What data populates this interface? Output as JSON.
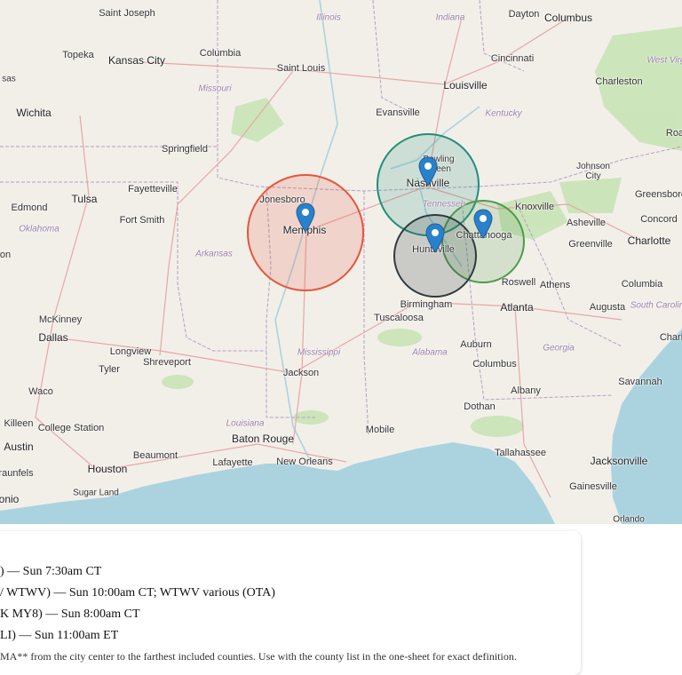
{
  "map": {
    "cities": [
      {
        "name": "Saint Joseph"
      },
      {
        "name": "Topeka"
      },
      {
        "name": "Kansas City"
      },
      {
        "name": "Columbia"
      },
      {
        "name": "Saint Louis"
      },
      {
        "name": "Wichita"
      },
      {
        "name": "Springfield"
      },
      {
        "name": "Fayetteville"
      },
      {
        "name": "Tulsa"
      },
      {
        "name": "Edmond"
      },
      {
        "name": "Fort Smith"
      },
      {
        "name": "Jonesboro"
      },
      {
        "name": "Memphis"
      },
      {
        "name": "McKinney"
      },
      {
        "name": "Dallas"
      },
      {
        "name": "Longview"
      },
      {
        "name": "Tyler"
      },
      {
        "name": "Shreveport"
      },
      {
        "name": "Waco"
      },
      {
        "name": "Killeen"
      },
      {
        "name": "College Station"
      },
      {
        "name": "Austin"
      },
      {
        "name": "Houston"
      },
      {
        "name": "Sugar Land"
      },
      {
        "name": "Beaumont"
      },
      {
        "name": "Lafayette"
      },
      {
        "name": "Baton Rouge"
      },
      {
        "name": "New Orleans"
      },
      {
        "name": "Jackson"
      },
      {
        "name": "Mobile"
      },
      {
        "name": "Tuscaloosa"
      },
      {
        "name": "Birmingham"
      },
      {
        "name": "Huntsville"
      },
      {
        "name": "Nashville"
      },
      {
        "name": "Bowling Green"
      },
      {
        "name": "Chattanooga"
      },
      {
        "name": "Knoxville"
      },
      {
        "name": "Johnson City"
      },
      {
        "name": "Asheville"
      },
      {
        "name": "Greenville"
      },
      {
        "name": "Charlotte"
      },
      {
        "name": "Greensboro"
      },
      {
        "name": "Concord"
      },
      {
        "name": "Roswell"
      },
      {
        "name": "Athens"
      },
      {
        "name": "Atlanta"
      },
      {
        "name": "Augusta"
      },
      {
        "name": "Columbia"
      },
      {
        "name": "Auburn"
      },
      {
        "name": "Columbus"
      },
      {
        "name": "Albany"
      },
      {
        "name": "Dothan"
      },
      {
        "name": "Tallahassee"
      },
      {
        "name": "Jacksonville"
      },
      {
        "name": "Gainesville"
      },
      {
        "name": "Savannah"
      },
      {
        "name": "Louisville"
      },
      {
        "name": "Evansville"
      },
      {
        "name": "Cincinnati"
      },
      {
        "name": "Dayton"
      },
      {
        "name": "Columbus"
      },
      {
        "name": "Charleston"
      },
      {
        "name": "Roa"
      },
      {
        "name": "Charl"
      },
      {
        "name": "onio"
      },
      {
        "name": "raunfels"
      },
      {
        "name": "on"
      },
      {
        "name": "sas"
      },
      {
        "name": "Orlando"
      }
    ],
    "states": [
      {
        "name": "Illinois"
      },
      {
        "name": "Indiana"
      },
      {
        "name": "Missouri"
      },
      {
        "name": "Kentucky"
      },
      {
        "name": "West Virg"
      },
      {
        "name": "Oklahoma"
      },
      {
        "name": "Arkansas"
      },
      {
        "name": "Tennessee"
      },
      {
        "name": "Mississippi"
      },
      {
        "name": "Alabama"
      },
      {
        "name": "Georgia"
      },
      {
        "name": "Louisiana"
      },
      {
        "name": "South Carolin"
      }
    ],
    "markets": [
      {
        "name": "Memphis",
        "color": "#e8553b"
      },
      {
        "name": "Nashville",
        "color": "#1f8f7a"
      },
      {
        "name": "Huntsville",
        "color": "#2d3a3f"
      },
      {
        "name": "Chattanooga",
        "color": "#4f9a4a"
      }
    ],
    "pin_color": "#2a81cb"
  },
  "panel": {
    "lines": [
      ") — Sun 7:30am CT",
      "/ WTWV) — Sun 10:00am CT; WTWV various (OTA)",
      "K MY8) — Sun 8:00am CT",
      "LI) — Sun 11:00am ET"
    ],
    "note": "MA** from the city center to the farthest included counties. Use with the county list in the one-sheet for exact definition."
  }
}
